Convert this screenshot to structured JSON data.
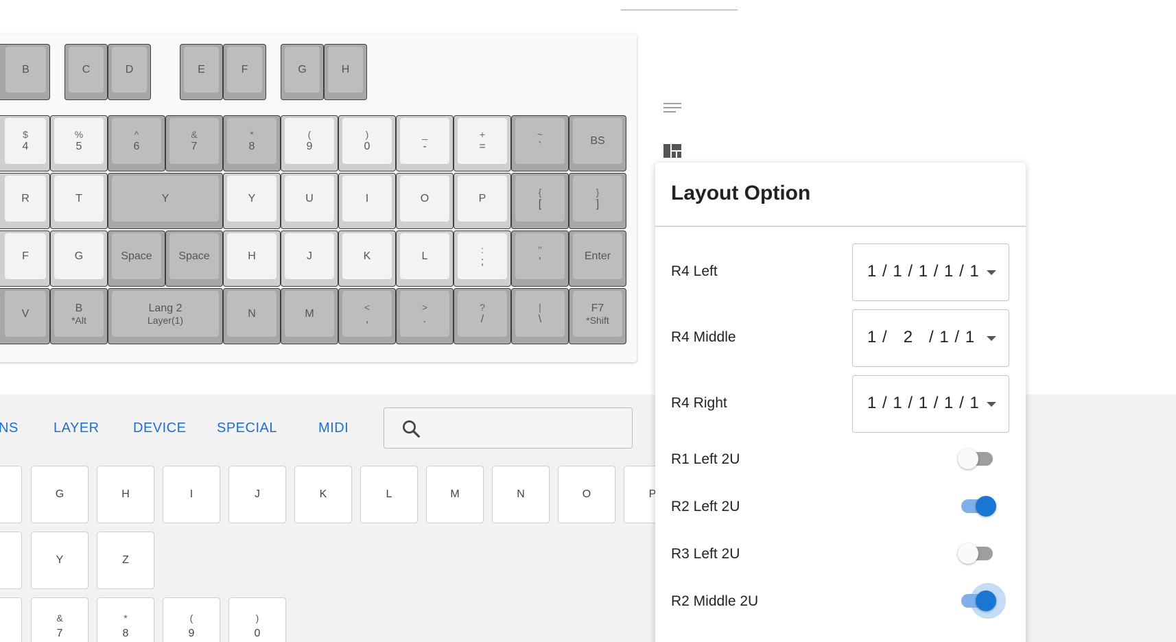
{
  "header": {
    "tab_fragment": ""
  },
  "keyboard": {
    "layout_keys": [
      "B",
      "C",
      "D",
      "E",
      "F",
      "G",
      "H"
    ],
    "row1": [
      {
        "shift": "$",
        "main": "4"
      },
      {
        "shift": "%",
        "main": "5"
      },
      {
        "shift": "^",
        "main": "6"
      },
      {
        "shift": "&",
        "main": "7"
      },
      {
        "shift": "*",
        "main": "8"
      },
      {
        "shift": "(",
        "main": "9"
      },
      {
        "shift": ")",
        "main": "0"
      },
      {
        "shift": "_",
        "main": "-"
      },
      {
        "shift": "+",
        "main": "="
      },
      {
        "shift": "~",
        "main": "`"
      },
      {
        "shift": "",
        "main": "BS"
      }
    ],
    "row2": [
      {
        "shift": "",
        "main": "R"
      },
      {
        "shift": "",
        "main": "T"
      },
      {
        "shift": "",
        "main": "Y"
      },
      {
        "shift": "",
        "main": "Y"
      },
      {
        "shift": "",
        "main": "U"
      },
      {
        "shift": "",
        "main": "I"
      },
      {
        "shift": "",
        "main": "O"
      },
      {
        "shift": "",
        "main": "P"
      },
      {
        "shift": "{",
        "main": "["
      },
      {
        "shift": "}",
        "main": "]"
      }
    ],
    "row3": [
      {
        "shift": "",
        "main": "F"
      },
      {
        "shift": "",
        "main": "G"
      },
      {
        "shift": "",
        "main": "Space"
      },
      {
        "shift": "",
        "main": "Space"
      },
      {
        "shift": "",
        "main": "H"
      },
      {
        "shift": "",
        "main": "J"
      },
      {
        "shift": "",
        "main": "K"
      },
      {
        "shift": "",
        "main": "L"
      },
      {
        "shift": ":",
        "main": ";"
      },
      {
        "shift": "\"",
        "main": "'"
      },
      {
        "shift": "",
        "main": "Enter"
      }
    ],
    "row4": [
      {
        "main": "V",
        "sub": ""
      },
      {
        "main": "B",
        "sub": "*Alt"
      },
      {
        "main": "Lang 2",
        "sub": "Layer(1)"
      },
      {
        "main": "N",
        "sub": ""
      },
      {
        "main": "M",
        "sub": ""
      },
      {
        "shift": "<",
        "main": ","
      },
      {
        "shift": ">",
        "main": "."
      },
      {
        "shift": "?",
        "main": "/"
      },
      {
        "shift": "|",
        "main": "\\"
      },
      {
        "main": "F7",
        "sub": "*Shift"
      }
    ]
  },
  "keycode_tabs": [
    "NS",
    "LAYER",
    "DEVICE",
    "SPECIAL",
    "MIDI"
  ],
  "search": {
    "placeholder": ""
  },
  "keycodes": {
    "row1": [
      "G",
      "H",
      "I",
      "J",
      "K",
      "L",
      "M",
      "N",
      "O",
      "P"
    ],
    "row2": [
      "Y",
      "Z"
    ],
    "row3": [
      {
        "shift": "&",
        "main": "7"
      },
      {
        "shift": "*",
        "main": "8"
      },
      {
        "shift": "(",
        "main": "9"
      },
      {
        "shift": ")",
        "main": "0"
      }
    ]
  },
  "side_icons": [
    "menu-lines-icon",
    "layout-grid-icon"
  ],
  "layout_option": {
    "title": "Layout Option",
    "selects": [
      {
        "label": "R4 Left",
        "value": "1 / 1 / 1 / 1 / 1"
      },
      {
        "label": "R4 Middle",
        "value": "1 /   2   / 1 / 1"
      },
      {
        "label": "R4 Right",
        "value": "1 / 1 / 1 / 1 / 1"
      }
    ],
    "toggles": [
      {
        "label": "R1 Left 2U",
        "on": false
      },
      {
        "label": "R2 Left 2U",
        "on": true
      },
      {
        "label": "R3 Left 2U",
        "on": false
      },
      {
        "label": "R2 Middle 2U",
        "on": true
      }
    ]
  },
  "colors": {
    "accent": "#1976d2",
    "tab_text": "#1e6fd0"
  }
}
